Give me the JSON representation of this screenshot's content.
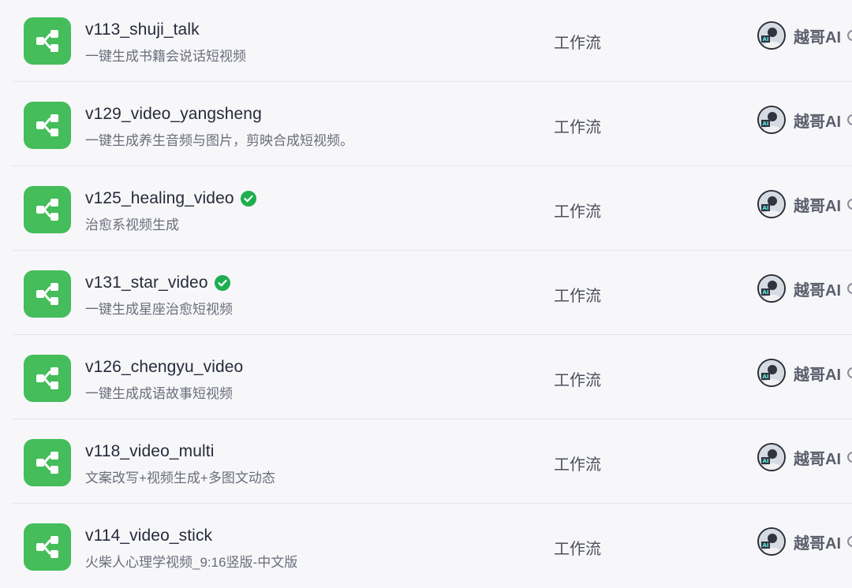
{
  "rows": [
    {
      "title": "v113_shuji_talk",
      "desc": "一键生成书籍会说话短视频",
      "verified": false,
      "type": "工作流",
      "author": "越哥AI"
    },
    {
      "title": "v129_video_yangsheng",
      "desc": "一键生成养生音频与图片，剪映合成短视频。",
      "verified": false,
      "type": "工作流",
      "author": "越哥AI"
    },
    {
      "title": "v125_healing_video",
      "desc": "治愈系视频生成",
      "verified": true,
      "type": "工作流",
      "author": "越哥AI"
    },
    {
      "title": "v131_star_video",
      "desc": "一键生成星座治愈短视频",
      "verified": true,
      "type": "工作流",
      "author": "越哥AI"
    },
    {
      "title": "v126_chengyu_video",
      "desc": "一键生成成语故事短视频",
      "verified": false,
      "type": "工作流",
      "author": "越哥AI"
    },
    {
      "title": "v118_video_multi",
      "desc": "文案改写+视频生成+多图文动态",
      "verified": false,
      "type": "工作流",
      "author": "越哥AI"
    },
    {
      "title": "v114_video_stick",
      "desc": "火柴人心理学视频_9:16竖版-中文版",
      "verified": false,
      "type": "工作流",
      "author": "越哥AI"
    }
  ],
  "icons": {
    "row_icon": "workflow-icon",
    "verified": "verified-check-icon",
    "avatar": "author-avatar",
    "author_more": "more-icon"
  },
  "colors": {
    "workflow_icon_bg": "#44bd5a",
    "verified_badge": "#1fae4f"
  }
}
